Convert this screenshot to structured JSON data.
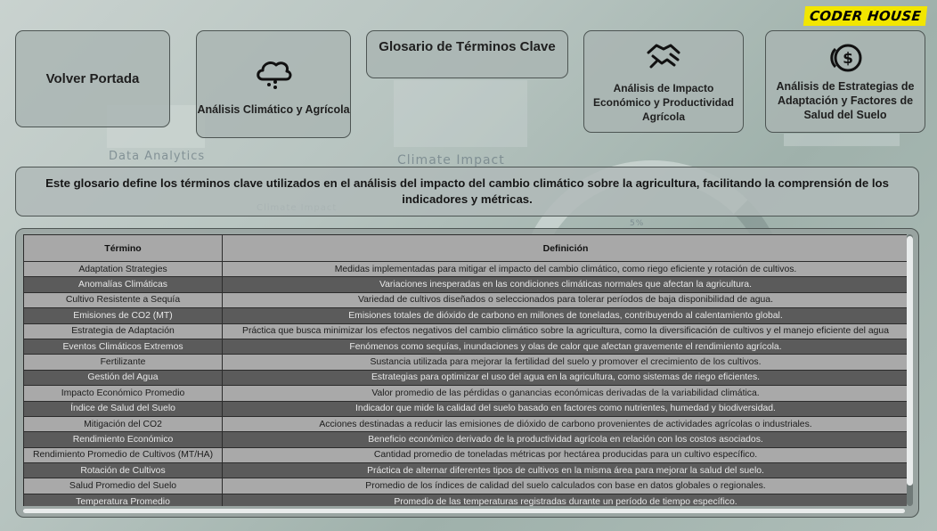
{
  "brand": {
    "logo_text": "CODER HOUSE"
  },
  "background": {
    "words": [
      "Data Analytics",
      "Climate Impact",
      "Climate Impact",
      "5%"
    ]
  },
  "nav": {
    "portada": {
      "label": "Volver Portada"
    },
    "clima": {
      "label": "Análisis Climático y Agrícola",
      "icon": "cloud-rain-icon"
    },
    "glosario": {
      "label": "Glosario de Términos Clave"
    },
    "impacto": {
      "label": "Análisis de Impacto Económico y Productividad Agrícola",
      "icon": "handshake-icon"
    },
    "estrategias": {
      "label": "Análisis de Estrategias de Adaptación y Factores de Salud del Suelo",
      "icon": "coins-icon"
    }
  },
  "intro": {
    "text": "Este glosario define los términos clave utilizados en el análisis del impacto del cambio climático sobre la agricultura, facilitando la comprensión de los indicadores y métricas."
  },
  "table": {
    "headers": [
      "Término",
      "Definición"
    ],
    "rows": [
      [
        "Adaptation Strategies",
        "Medidas implementadas para mitigar el impacto del cambio climático, como riego eficiente y rotación de cultivos."
      ],
      [
        "Anomalías Climáticas",
        "Variaciones inesperadas en las condiciones climáticas normales que afectan la agricultura."
      ],
      [
        "Cultivo Resistente a Sequía",
        "Variedad de cultivos diseñados o seleccionados para tolerar períodos de baja disponibilidad de agua."
      ],
      [
        "Emisiones de CO2 (MT)",
        "Emisiones totales de dióxido de carbono en millones de toneladas, contribuyendo al calentamiento global."
      ],
      [
        "Estrategia de Adaptación",
        "Práctica que busca minimizar los efectos negativos del cambio climático sobre la agricultura, como la diversificación de cultivos y el manejo eficiente del agua"
      ],
      [
        "Eventos Climáticos Extremos",
        "Fenómenos como sequías, inundaciones y olas de calor que afectan gravemente el rendimiento agrícola."
      ],
      [
        "Fertilizante",
        "Sustancia utilizada para mejorar la fertilidad del suelo y promover el crecimiento de los cultivos."
      ],
      [
        "Gestión del Agua",
        "Estrategias para optimizar el uso del agua en la agricultura, como sistemas de riego eficientes."
      ],
      [
        "Impacto Económico Promedio",
        "Valor promedio de las pérdidas o ganancias económicas derivadas de la variabilidad climática."
      ],
      [
        "Índice de Salud del Suelo",
        "Indicador que mide la calidad del suelo basado en factores como nutrientes, humedad y biodiversidad."
      ],
      [
        "Mitigación del CO2",
        "Acciones destinadas a reducir las emisiones de dióxido de carbono provenientes de actividades agrícolas o industriales."
      ],
      [
        "Rendimiento Económico",
        "Beneficio económico derivado de la productividad agrícola en relación con los costos asociados."
      ],
      [
        "Rendimiento Promedio de Cultivos (MT/HA)",
        "Cantidad promedio de toneladas métricas por hectárea producidas para un cultivo específico."
      ],
      [
        "Rotación de Cultivos",
        "Práctica de alternar diferentes tipos de cultivos en la misma área para mejorar la salud del suelo."
      ],
      [
        "Salud Promedio del Suelo",
        "Promedio de los índices de calidad del suelo calculados con base en datos globales o regionales."
      ],
      [
        "Temperatura Promedio",
        "Promedio de las temperaturas registradas durante un período de tiempo específico."
      ]
    ]
  }
}
